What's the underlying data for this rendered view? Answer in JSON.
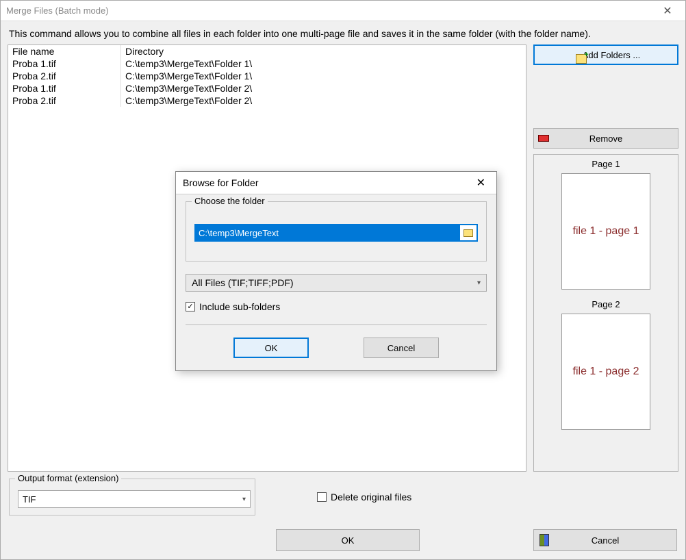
{
  "window": {
    "title": "Merge Files (Batch mode)"
  },
  "instructions": "This command allows you to combine all files in each folder into one multi-page file and saves it in the same folder (with the folder name).",
  "table": {
    "col_filename": "File name",
    "col_directory": "Directory",
    "rows": [
      {
        "fn": "Proba 1.tif",
        "dir": "C:\\temp3\\MergeText\\Folder 1\\"
      },
      {
        "fn": "Proba 2.tif",
        "dir": "C:\\temp3\\MergeText\\Folder 1\\"
      },
      {
        "fn": "Proba 1.tif",
        "dir": "C:\\temp3\\MergeText\\Folder 2\\"
      },
      {
        "fn": "Proba 2.tif",
        "dir": "C:\\temp3\\MergeText\\Folder 2\\"
      }
    ]
  },
  "buttons": {
    "add_folders": "Add Folders ...",
    "remove": "Remove",
    "ok": "OK",
    "cancel": "Cancel"
  },
  "preview": {
    "pages": [
      {
        "label": "Page 1",
        "content": "file 1 - page 1"
      },
      {
        "label": "Page 2",
        "content": "file 1 - page 2"
      }
    ]
  },
  "output": {
    "legend": "Output format (extension)",
    "value": "TIF",
    "delete_original": "Delete original files",
    "delete_checked": false
  },
  "browse": {
    "title": "Browse for Folder",
    "legend": "Choose the folder",
    "path": "C:\\temp3\\MergeText",
    "filter": "All Files (TIF;TIFF;PDF)",
    "include_sub": "Include sub-folders",
    "include_checked": true,
    "ok": "OK",
    "cancel": "Cancel"
  }
}
